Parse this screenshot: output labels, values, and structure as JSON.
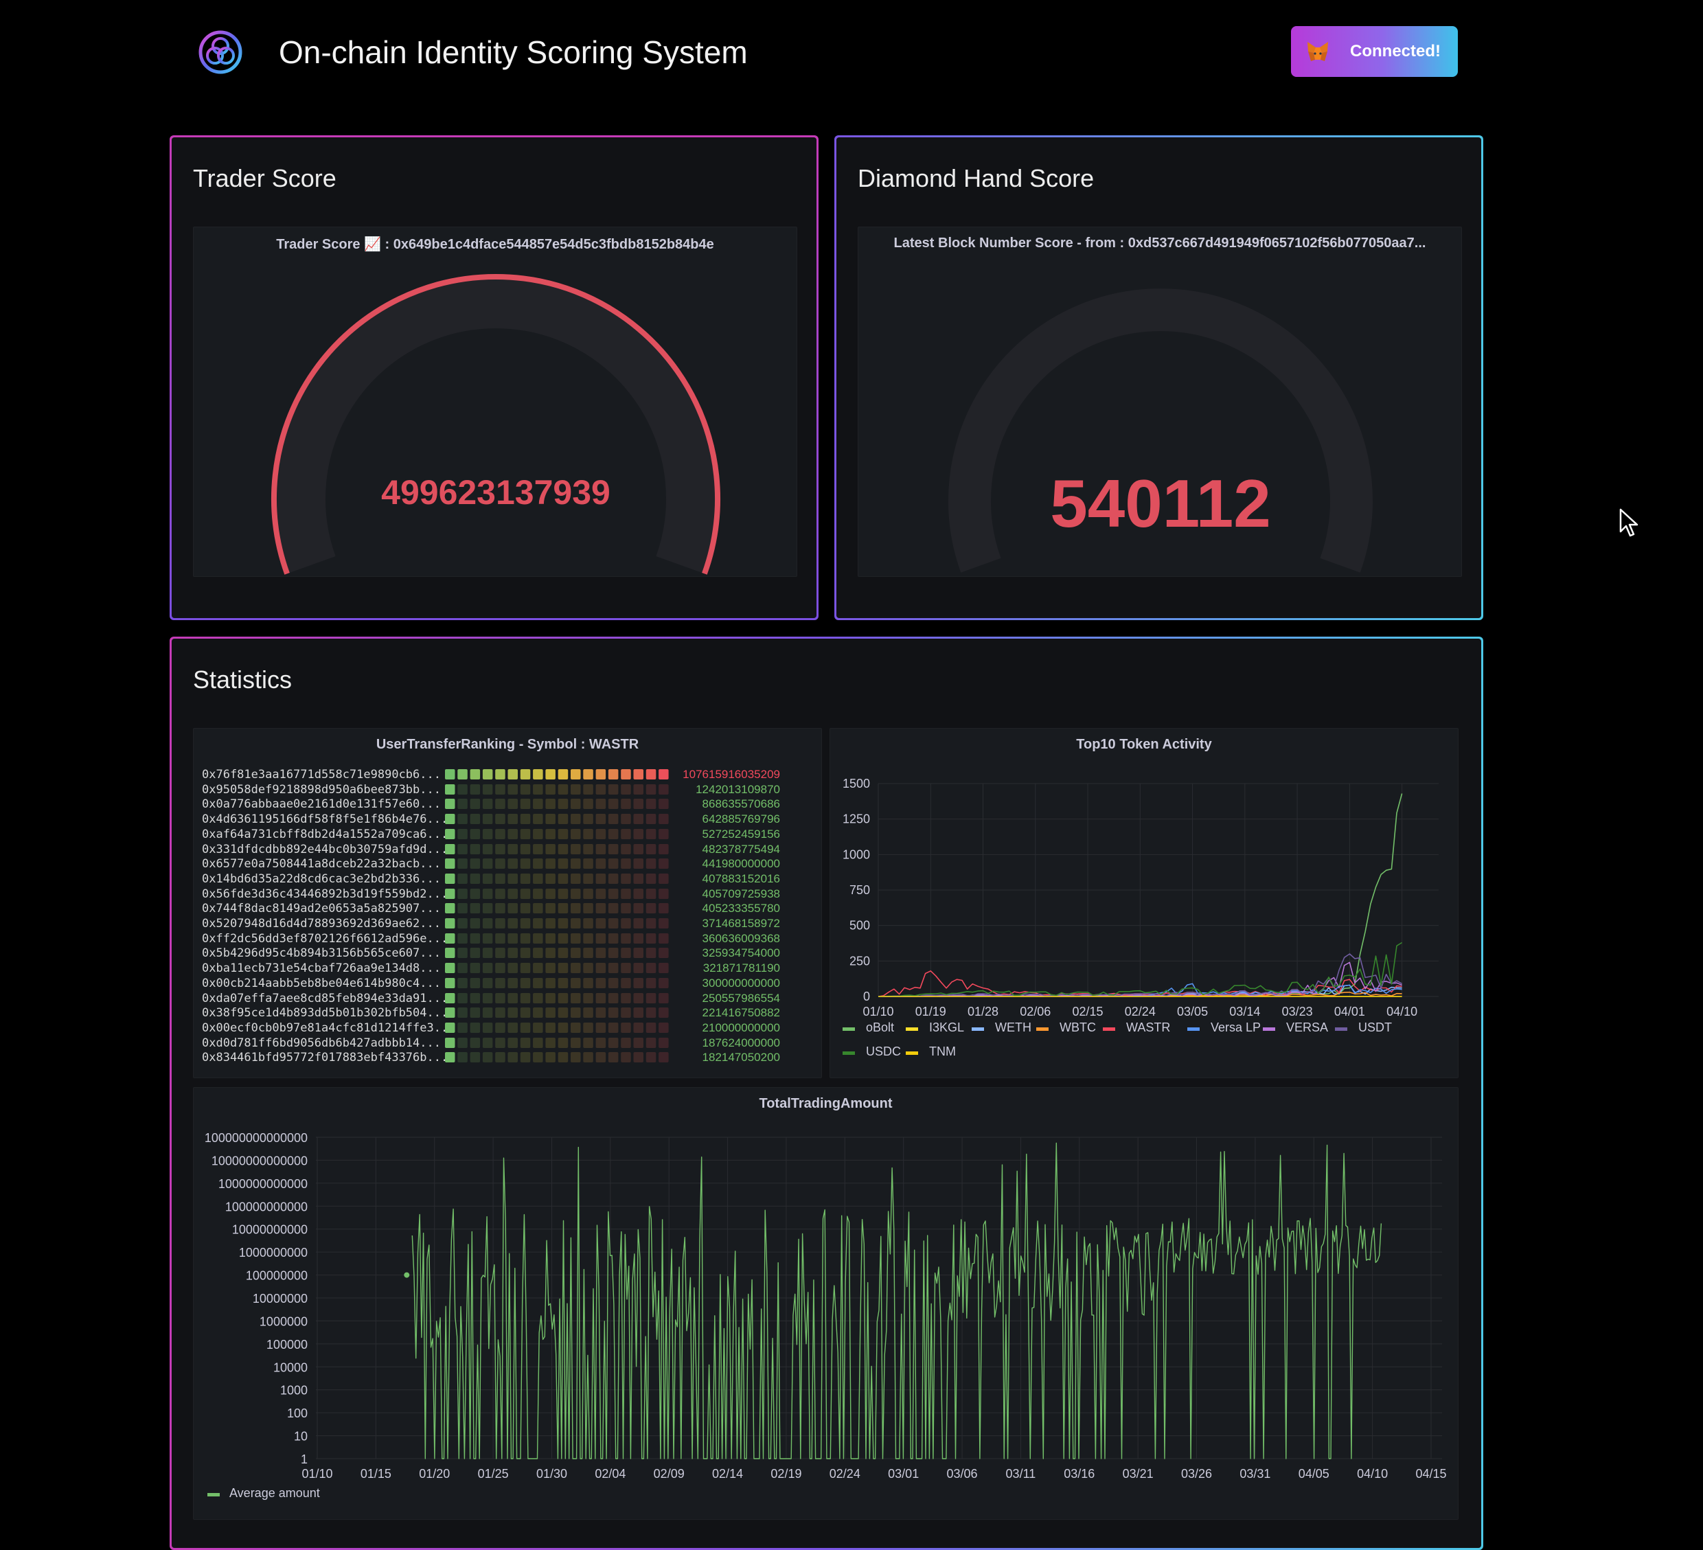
{
  "header": {
    "title": "On-chain Identity Scoring System",
    "connect_label": "Connected!"
  },
  "trader_panel": {
    "title": "Trader Score",
    "viz_title": "Trader Score 📈 : 0x649be1c4dface544857e54d5c3fbdb8152b84b4e",
    "value": "499623137939",
    "fraction": 1.0,
    "color": "#e0505e"
  },
  "diamond_panel": {
    "title": "Diamond Hand Score",
    "viz_title": "Latest Block Number Score - from : 0xd537c667d491949f0657102f56b077050aa7...",
    "value": "540112",
    "fraction": 0.0,
    "color": "#e0505e"
  },
  "stats_panel": {
    "title": "Statistics",
    "ranking": {
      "title": "UserTransferRanking - Symbol : WASTR",
      "rows": [
        {
          "address": "0x76f81e3aa16771d558c71e9890cb6...",
          "value": "107615916035209",
          "fraction": 1.0
        },
        {
          "address": "0x95058def9218898d950a6bee873bb...",
          "value": "1242013109870",
          "fraction": 0.04
        },
        {
          "address": "0x0a776abbaae0e2161d0e131f57e60...",
          "value": "868635570686",
          "fraction": 0.03
        },
        {
          "address": "0x4d6361195166df58f8f5e1f86b4e76...",
          "value": "642885769796",
          "fraction": 0.02
        },
        {
          "address": "0xaf64a731cbff8db2d4a1552a709ca6...",
          "value": "527252459156",
          "fraction": 0.02
        },
        {
          "address": "0x331dfdcdbb892e44bc0b30759afd9d...",
          "value": "482378775494",
          "fraction": 0.02
        },
        {
          "address": "0x6577e0a7508441a8dceb22a32bacb...",
          "value": "441980000000",
          "fraction": 0.02
        },
        {
          "address": "0x14bd6d35a22d8cd6cac3e2bd2b336...",
          "value": "407883152016",
          "fraction": 0.02
        },
        {
          "address": "0x56fde3d36c43446892b3d19f559bd2...",
          "value": "405709725938",
          "fraction": 0.02
        },
        {
          "address": "0x744f8dac8149ad2e0653a5a825907...",
          "value": "405233355780",
          "fraction": 0.02
        },
        {
          "address": "0x5207948d16d4d78893692d369ae62...",
          "value": "371468158972",
          "fraction": 0.02
        },
        {
          "address": "0xff2dc56dd3ef8702126f6612ad596e...",
          "value": "360636009368",
          "fraction": 0.02
        },
        {
          "address": "0x5b4296d95c4b894b3156b565ce607...",
          "value": "325934754000",
          "fraction": 0.02
        },
        {
          "address": "0xba11ecb731e54cbaf726aa9e134d8...",
          "value": "321871781190",
          "fraction": 0.02
        },
        {
          "address": "0x00cb214aabb5eb8be04e614b980c4...",
          "value": "300000000000",
          "fraction": 0.02
        },
        {
          "address": "0xda07effa7aee8cd85feb894e33da91...",
          "value": "250557986554",
          "fraction": 0.02
        },
        {
          "address": "0x38f95ce1d4b893dd5b01b302bfb504...",
          "value": "221416750882",
          "fraction": 0.02
        },
        {
          "address": "0x00ecf0cb0b97e81a4cfc81d1214ffe3...",
          "value": "210000000000",
          "fraction": 0.02
        },
        {
          "address": "0xd0d781ff6bd9056db6b427adbbb14...",
          "value": "187624000000",
          "fraction": 0.02
        },
        {
          "address": "0x834461bfd95772f017883ebf43376b...",
          "value": "182147050200",
          "fraction": 0.02
        }
      ],
      "colors": {
        "high": "#f2495c",
        "low": "#73bf69"
      }
    },
    "token_chart": {
      "title": "Top10 Token Activity",
      "chart_data": {
        "type": "line",
        "title": "Top10 Token Activity",
        "x": [
          "01/10",
          "01/19",
          "01/28",
          "02/06",
          "02/15",
          "02/24",
          "03/05",
          "03/14",
          "03/23",
          "04/01",
          "04/10"
        ],
        "ylim": [
          0,
          1500
        ],
        "yticks": [
          "0",
          "250",
          "500",
          "750",
          "1000",
          "1250",
          "1500"
        ],
        "grid": true,
        "legend_position": "bottom",
        "series": [
          {
            "name": "oBolt",
            "color": "#73bf69",
            "values": [
              0,
              2,
              5,
              3,
              4,
              6,
              8,
              10,
              25,
              60,
              1430
            ]
          },
          {
            "name": "I3KGL",
            "color": "#fade2a",
            "values": [
              0,
              0,
              0,
              0,
              0,
              0,
              0,
              0,
              0,
              0,
              0
            ]
          },
          {
            "name": "WETH",
            "color": "#8ab8ff",
            "values": [
              0,
              5,
              10,
              6,
              8,
              10,
              20,
              25,
              35,
              80,
              60
            ]
          },
          {
            "name": "WBTC",
            "color": "#ff9830",
            "values": [
              0,
              3,
              6,
              4,
              4,
              5,
              8,
              10,
              15,
              30,
              20
            ]
          },
          {
            "name": "WASTR",
            "color": "#f2495c",
            "values": [
              0,
              180,
              60,
              25,
              20,
              20,
              30,
              35,
              40,
              120,
              70
            ]
          },
          {
            "name": "Versa LP",
            "color": "#5794f2",
            "values": [
              0,
              2,
              4,
              3,
              3,
              4,
              90,
              30,
              40,
              80,
              50
            ]
          },
          {
            "name": "VERSA",
            "color": "#b877d9",
            "values": [
              0,
              5,
              10,
              8,
              8,
              10,
              15,
              20,
              30,
              240,
              80
            ]
          },
          {
            "name": "USDT",
            "color": "#705da0",
            "values": [
              0,
              10,
              20,
              15,
              15,
              20,
              30,
              40,
              50,
              300,
              90
            ]
          },
          {
            "name": "USDC",
            "color": "#37872d",
            "values": [
              0,
              20,
              40,
              30,
              30,
              40,
              60,
              80,
              100,
              150,
              380
            ]
          },
          {
            "name": "TNM",
            "color": "#f2cc0c",
            "values": [
              0,
              0,
              0,
              0,
              0,
              0,
              0,
              0,
              0,
              0,
              0
            ]
          }
        ]
      }
    },
    "trading_chart": {
      "title": "TotalTradingAmount",
      "chart_data": {
        "type": "line",
        "title": "TotalTradingAmount",
        "scale": "log",
        "x": [
          "01/10",
          "01/15",
          "01/20",
          "01/25",
          "01/30",
          "02/04",
          "02/09",
          "02/14",
          "02/19",
          "02/24",
          "03/01",
          "03/06",
          "03/11",
          "03/16",
          "03/21",
          "03/26",
          "03/31",
          "04/05",
          "04/10",
          "04/15"
        ],
        "yticks": [
          "1",
          "10",
          "100",
          "1000",
          "10000",
          "100000",
          "1000000",
          "10000000",
          "100000000",
          "1000000000",
          "10000000000",
          "100000000000",
          "1000000000000",
          "10000000000000",
          "100000000000000"
        ],
        "grid": true,
        "legend_position": "bottom-left",
        "series": [
          {
            "name": "Average amount",
            "color": "#73bf69"
          }
        ]
      }
    }
  }
}
